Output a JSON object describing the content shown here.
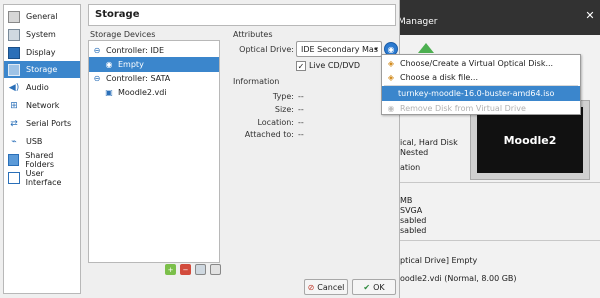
{
  "background_window": {
    "title": "Manager",
    "preview_label": "Moodle2",
    "details": [
      "ical, Hard Disk",
      "Nested",
      "ation",
      "MB",
      "SVGA",
      "sabled",
      "sabled",
      "ptical Drive] Empty",
      "oodle2.vdi (Normal, 8.00 GB)"
    ]
  },
  "sidebar": {
    "items": [
      {
        "label": "General",
        "icon": "general-icon"
      },
      {
        "label": "System",
        "icon": "system-icon"
      },
      {
        "label": "Display",
        "icon": "display-icon"
      },
      {
        "label": "Storage",
        "icon": "storage-icon"
      },
      {
        "label": "Audio",
        "icon": "audio-icon"
      },
      {
        "label": "Network",
        "icon": "network-icon"
      },
      {
        "label": "Serial Ports",
        "icon": "serial-ports-icon"
      },
      {
        "label": "USB",
        "icon": "usb-icon"
      },
      {
        "label": "Shared Folders",
        "icon": "shared-folders-icon"
      },
      {
        "label": "User Interface",
        "icon": "user-interface-icon"
      }
    ],
    "active": "Storage"
  },
  "page": {
    "title": "Storage"
  },
  "storage_devices": {
    "heading": "Storage Devices",
    "tree": [
      {
        "label": "Controller: IDE",
        "type": "controller"
      },
      {
        "label": "Empty",
        "type": "optical",
        "selected": true
      },
      {
        "label": "Controller: SATA",
        "type": "controller"
      },
      {
        "label": "Moodle2.vdi",
        "type": "disk"
      }
    ]
  },
  "attributes": {
    "heading": "Attributes",
    "optical_drive_label": "Optical Drive:",
    "optical_drive_value": "IDE Secondary Mas",
    "live_cd_label": "Live CD/DVD",
    "live_cd_checked": true
  },
  "information": {
    "heading": "Information",
    "rows": [
      {
        "label": "Type:",
        "value": "--"
      },
      {
        "label": "Size:",
        "value": "--"
      },
      {
        "label": "Location:",
        "value": "--"
      },
      {
        "label": "Attached to:",
        "value": "--"
      }
    ]
  },
  "buttons": {
    "cancel": "Cancel",
    "ok": "OK"
  },
  "menu": {
    "items": [
      {
        "label": "Choose/Create a Virtual Optical Disk...",
        "icon": "optical-disk-create-icon"
      },
      {
        "label": "Choose a disk file...",
        "icon": "optical-disk-file-icon"
      },
      {
        "label": "turnkey-moodle-16.0-buster-amd64.iso",
        "highlight": true
      },
      {
        "label": "Remove Disk from Virtual Drive",
        "icon": "remove-disk-icon",
        "disabled": true
      }
    ]
  },
  "colors": {
    "selection": "#3b86cc",
    "titlebar": "#323232"
  }
}
